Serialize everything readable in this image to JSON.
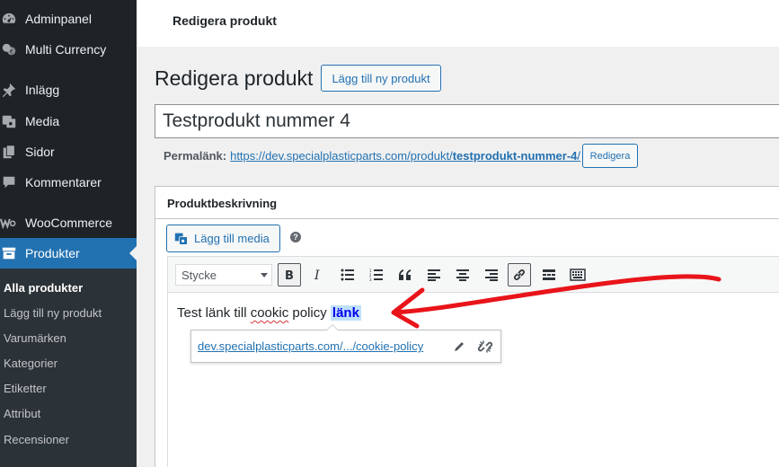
{
  "sidebar": {
    "items": [
      {
        "label": "Adminpanel",
        "icon": "gauge-icon"
      },
      {
        "label": "Multi Currency",
        "icon": "currency-icon"
      },
      {
        "label": "Inlägg",
        "icon": "pin-icon"
      },
      {
        "label": "Media",
        "icon": "media-icon"
      },
      {
        "label": "Sidor",
        "icon": "pages-icon"
      },
      {
        "label": "Kommentarer",
        "icon": "comment-icon"
      },
      {
        "label": "WooCommerce",
        "icon": "woo-icon"
      },
      {
        "label": "Produkter",
        "icon": "archive-icon"
      }
    ],
    "submenu": [
      "Alla produkter",
      "Lägg till ny produkt",
      "Varumärken",
      "Kategorier",
      "Etiketter",
      "Attribut",
      "Recensioner"
    ]
  },
  "topbar": {
    "title": "Redigera produkt"
  },
  "page": {
    "title": "Redigera produkt",
    "add_new": "Lägg till ny produkt"
  },
  "post": {
    "title": "Testprodukt nummer 4",
    "permalink_label": "Permalänk:",
    "permalink_base": "https://dev.specialplasticparts.com/produkt/",
    "permalink_slug": "testprodukt-nummer-4",
    "permalink_trail": "/",
    "edit_slug": "Redigera"
  },
  "postbox": {
    "title": "Produktbeskrivning"
  },
  "editor": {
    "add_media": "Lägg till media",
    "format_select": "Stycke",
    "content": {
      "before": "Test länk till ",
      "misspelled": "cookic",
      "middle": " policy ",
      "link": "länk"
    },
    "link_popup_url": "dev.specialplasticparts.com/.../cookie-policy"
  },
  "colors": {
    "annotation": "#e8141a",
    "accent": "#2271b1",
    "sidebar": "#1d2327"
  }
}
